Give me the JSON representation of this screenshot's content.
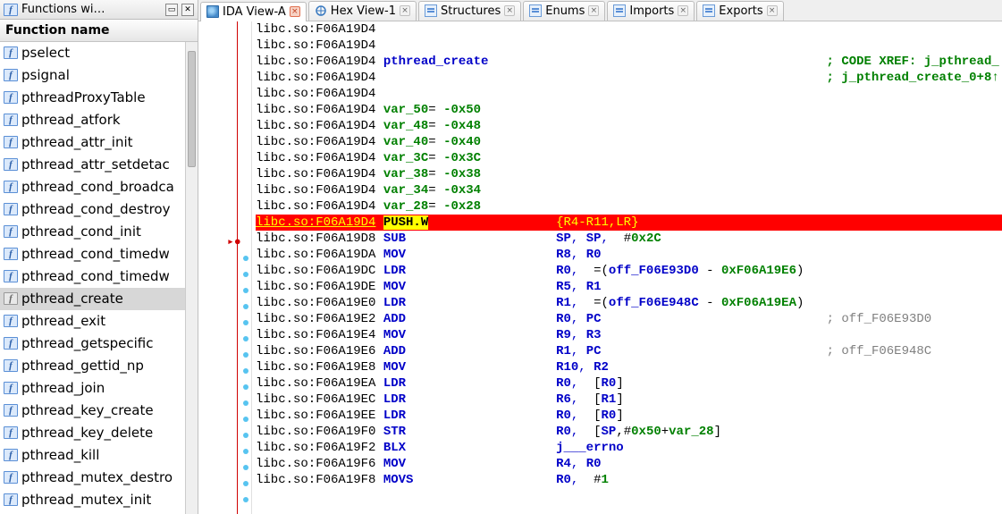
{
  "sidebar": {
    "title": "Functions wi…",
    "column_header": "Function name",
    "items": [
      {
        "label": "pselect",
        "selected": false,
        "gray": false
      },
      {
        "label": "psignal",
        "selected": false,
        "gray": false
      },
      {
        "label": "pthreadProxyTable",
        "selected": false,
        "gray": false
      },
      {
        "label": "pthread_atfork",
        "selected": false,
        "gray": false
      },
      {
        "label": "pthread_attr_init",
        "selected": false,
        "gray": false
      },
      {
        "label": "pthread_attr_setdetac",
        "selected": false,
        "gray": false
      },
      {
        "label": "pthread_cond_broadca",
        "selected": false,
        "gray": false
      },
      {
        "label": "pthread_cond_destroy",
        "selected": false,
        "gray": false
      },
      {
        "label": "pthread_cond_init",
        "selected": false,
        "gray": false
      },
      {
        "label": "pthread_cond_timedw",
        "selected": false,
        "gray": false
      },
      {
        "label": "pthread_cond_timedw",
        "selected": false,
        "gray": false
      },
      {
        "label": "pthread_create",
        "selected": true,
        "gray": true
      },
      {
        "label": "pthread_exit",
        "selected": false,
        "gray": false
      },
      {
        "label": "pthread_getspecific",
        "selected": false,
        "gray": false
      },
      {
        "label": "pthread_gettid_np",
        "selected": false,
        "gray": false
      },
      {
        "label": "pthread_join",
        "selected": false,
        "gray": false
      },
      {
        "label": "pthread_key_create",
        "selected": false,
        "gray": false
      },
      {
        "label": "pthread_key_delete",
        "selected": false,
        "gray": false
      },
      {
        "label": "pthread_kill",
        "selected": false,
        "gray": false
      },
      {
        "label": "pthread_mutex_destro",
        "selected": false,
        "gray": false
      },
      {
        "label": "pthread_mutex_init",
        "selected": false,
        "gray": false
      }
    ]
  },
  "tabs": [
    {
      "label": "IDA View-A",
      "active": true,
      "icon": "disasm"
    },
    {
      "label": "Hex View-1",
      "active": false,
      "icon": "hex"
    },
    {
      "label": "Structures",
      "active": false,
      "icon": "doc"
    },
    {
      "label": "Enums",
      "active": false,
      "icon": "doc"
    },
    {
      "label": "Imports",
      "active": false,
      "icon": "doc"
    },
    {
      "label": "Exports",
      "active": false,
      "icon": "doc"
    }
  ],
  "disasm": {
    "addr_prefix": "libc.so:",
    "highlight_index": 12,
    "dot_start": 13,
    "lines": [
      {
        "a": "F06A19D4",
        "raw": ""
      },
      {
        "a": "F06A19D4",
        "raw": ""
      },
      {
        "a": "F06A19D4",
        "sym": "pthread_create",
        "xref": "; CODE XREF: j_pthread_"
      },
      {
        "a": "F06A19D4",
        "xref_only": "; j_pthread_create_0+8↑"
      },
      {
        "a": "F06A19D4",
        "raw": ""
      },
      {
        "a": "F06A19D4",
        "var": "var_50",
        "val": "-0x50"
      },
      {
        "a": "F06A19D4",
        "var": "var_48",
        "val": "-0x48"
      },
      {
        "a": "F06A19D4",
        "var": "var_40",
        "val": "-0x40"
      },
      {
        "a": "F06A19D4",
        "var": "var_3C",
        "val": "-0x3C"
      },
      {
        "a": "F06A19D4",
        "var": "var_38",
        "val": "-0x38"
      },
      {
        "a": "F06A19D4",
        "var": "var_34",
        "val": "-0x34"
      },
      {
        "a": "F06A19D4",
        "var": "var_28",
        "val": "-0x28"
      },
      {
        "a": "F06A19D4",
        "hl": true,
        "mnem": "PUSH.W",
        "ops": "{R4-R11,LR}"
      },
      {
        "a": "F06A19D8",
        "mnem": "SUB",
        "ops_parts": [
          {
            "t": "reg",
            "v": "SP"
          },
          {
            "t": "c"
          },
          {
            "t": "reg",
            "v": "SP"
          },
          {
            "t": "c"
          },
          {
            "t": "txt",
            "v": " #"
          },
          {
            "t": "num",
            "v": "0x2C"
          }
        ]
      },
      {
        "a": "F06A19DA",
        "mnem": "MOV",
        "ops_parts": [
          {
            "t": "reg",
            "v": "R8"
          },
          {
            "t": "c"
          },
          {
            "t": "reg",
            "v": "R0"
          }
        ]
      },
      {
        "a": "F06A19DC",
        "mnem": "LDR",
        "ops_parts": [
          {
            "t": "reg",
            "v": "R0"
          },
          {
            "t": "c"
          },
          {
            "t": "txt",
            "v": " =("
          },
          {
            "t": "sym",
            "v": "off_F06E93D0"
          },
          {
            "t": "txt",
            "v": " - "
          },
          {
            "t": "num",
            "v": "0xF06A19E6"
          },
          {
            "t": "txt",
            "v": ")"
          }
        ]
      },
      {
        "a": "F06A19DE",
        "mnem": "MOV",
        "ops_parts": [
          {
            "t": "reg",
            "v": "R5"
          },
          {
            "t": "c"
          },
          {
            "t": "reg",
            "v": "R1"
          }
        ]
      },
      {
        "a": "F06A19E0",
        "mnem": "LDR",
        "ops_parts": [
          {
            "t": "reg",
            "v": "R1"
          },
          {
            "t": "c"
          },
          {
            "t": "txt",
            "v": " =("
          },
          {
            "t": "sym",
            "v": "off_F06E948C"
          },
          {
            "t": "txt",
            "v": " - "
          },
          {
            "t": "num",
            "v": "0xF06A19EA"
          },
          {
            "t": "txt",
            "v": ")"
          }
        ]
      },
      {
        "a": "F06A19E2",
        "mnem": "ADD",
        "ops_parts": [
          {
            "t": "reg",
            "v": "R0"
          },
          {
            "t": "c"
          },
          {
            "t": "reg",
            "v": "PC"
          }
        ],
        "cmt": "; off_F06E93D0"
      },
      {
        "a": "F06A19E4",
        "mnem": "MOV",
        "ops_parts": [
          {
            "t": "reg",
            "v": "R9"
          },
          {
            "t": "c"
          },
          {
            "t": "reg",
            "v": "R3"
          }
        ]
      },
      {
        "a": "F06A19E6",
        "mnem": "ADD",
        "ops_parts": [
          {
            "t": "reg",
            "v": "R1"
          },
          {
            "t": "c"
          },
          {
            "t": "reg",
            "v": "PC"
          }
        ],
        "cmt": "; off_F06E948C"
      },
      {
        "a": "F06A19E8",
        "mnem": "MOV",
        "ops_parts": [
          {
            "t": "reg",
            "v": "R10"
          },
          {
            "t": "c"
          },
          {
            "t": "reg",
            "v": "R2"
          }
        ]
      },
      {
        "a": "F06A19EA",
        "mnem": "LDR",
        "ops_parts": [
          {
            "t": "reg",
            "v": "R0"
          },
          {
            "t": "c"
          },
          {
            "t": "txt",
            "v": " ["
          },
          {
            "t": "reg",
            "v": "R0"
          },
          {
            "t": "txt",
            "v": "]"
          }
        ]
      },
      {
        "a": "F06A19EC",
        "mnem": "LDR",
        "ops_parts": [
          {
            "t": "reg",
            "v": "R6"
          },
          {
            "t": "c"
          },
          {
            "t": "txt",
            "v": " ["
          },
          {
            "t": "reg",
            "v": "R1"
          },
          {
            "t": "txt",
            "v": "]"
          }
        ]
      },
      {
        "a": "F06A19EE",
        "mnem": "LDR",
        "ops_parts": [
          {
            "t": "reg",
            "v": "R0"
          },
          {
            "t": "c"
          },
          {
            "t": "txt",
            "v": " ["
          },
          {
            "t": "reg",
            "v": "R0"
          },
          {
            "t": "txt",
            "v": "]"
          }
        ]
      },
      {
        "a": "F06A19F0",
        "mnem": "STR",
        "ops_parts": [
          {
            "t": "reg",
            "v": "R0"
          },
          {
            "t": "c"
          },
          {
            "t": "txt",
            "v": " ["
          },
          {
            "t": "reg",
            "v": "SP"
          },
          {
            "t": "txt",
            "v": ",#"
          },
          {
            "t": "num",
            "v": "0x50"
          },
          {
            "t": "txt",
            "v": "+"
          },
          {
            "t": "var",
            "v": "var_28"
          },
          {
            "t": "txt",
            "v": "]"
          }
        ]
      },
      {
        "a": "F06A19F2",
        "mnem": "BLX",
        "ops_parts": [
          {
            "t": "sym",
            "v": "j___errno"
          }
        ]
      },
      {
        "a": "F06A19F6",
        "mnem": "MOV",
        "ops_parts": [
          {
            "t": "reg",
            "v": "R4"
          },
          {
            "t": "c"
          },
          {
            "t": "reg",
            "v": "R0"
          }
        ]
      },
      {
        "a": "F06A19F8",
        "mnem": "MOVS",
        "ops_parts": [
          {
            "t": "reg",
            "v": "R0"
          },
          {
            "t": "c"
          },
          {
            "t": "txt",
            "v": " #"
          },
          {
            "t": "num",
            "v": "1"
          }
        ]
      }
    ]
  }
}
